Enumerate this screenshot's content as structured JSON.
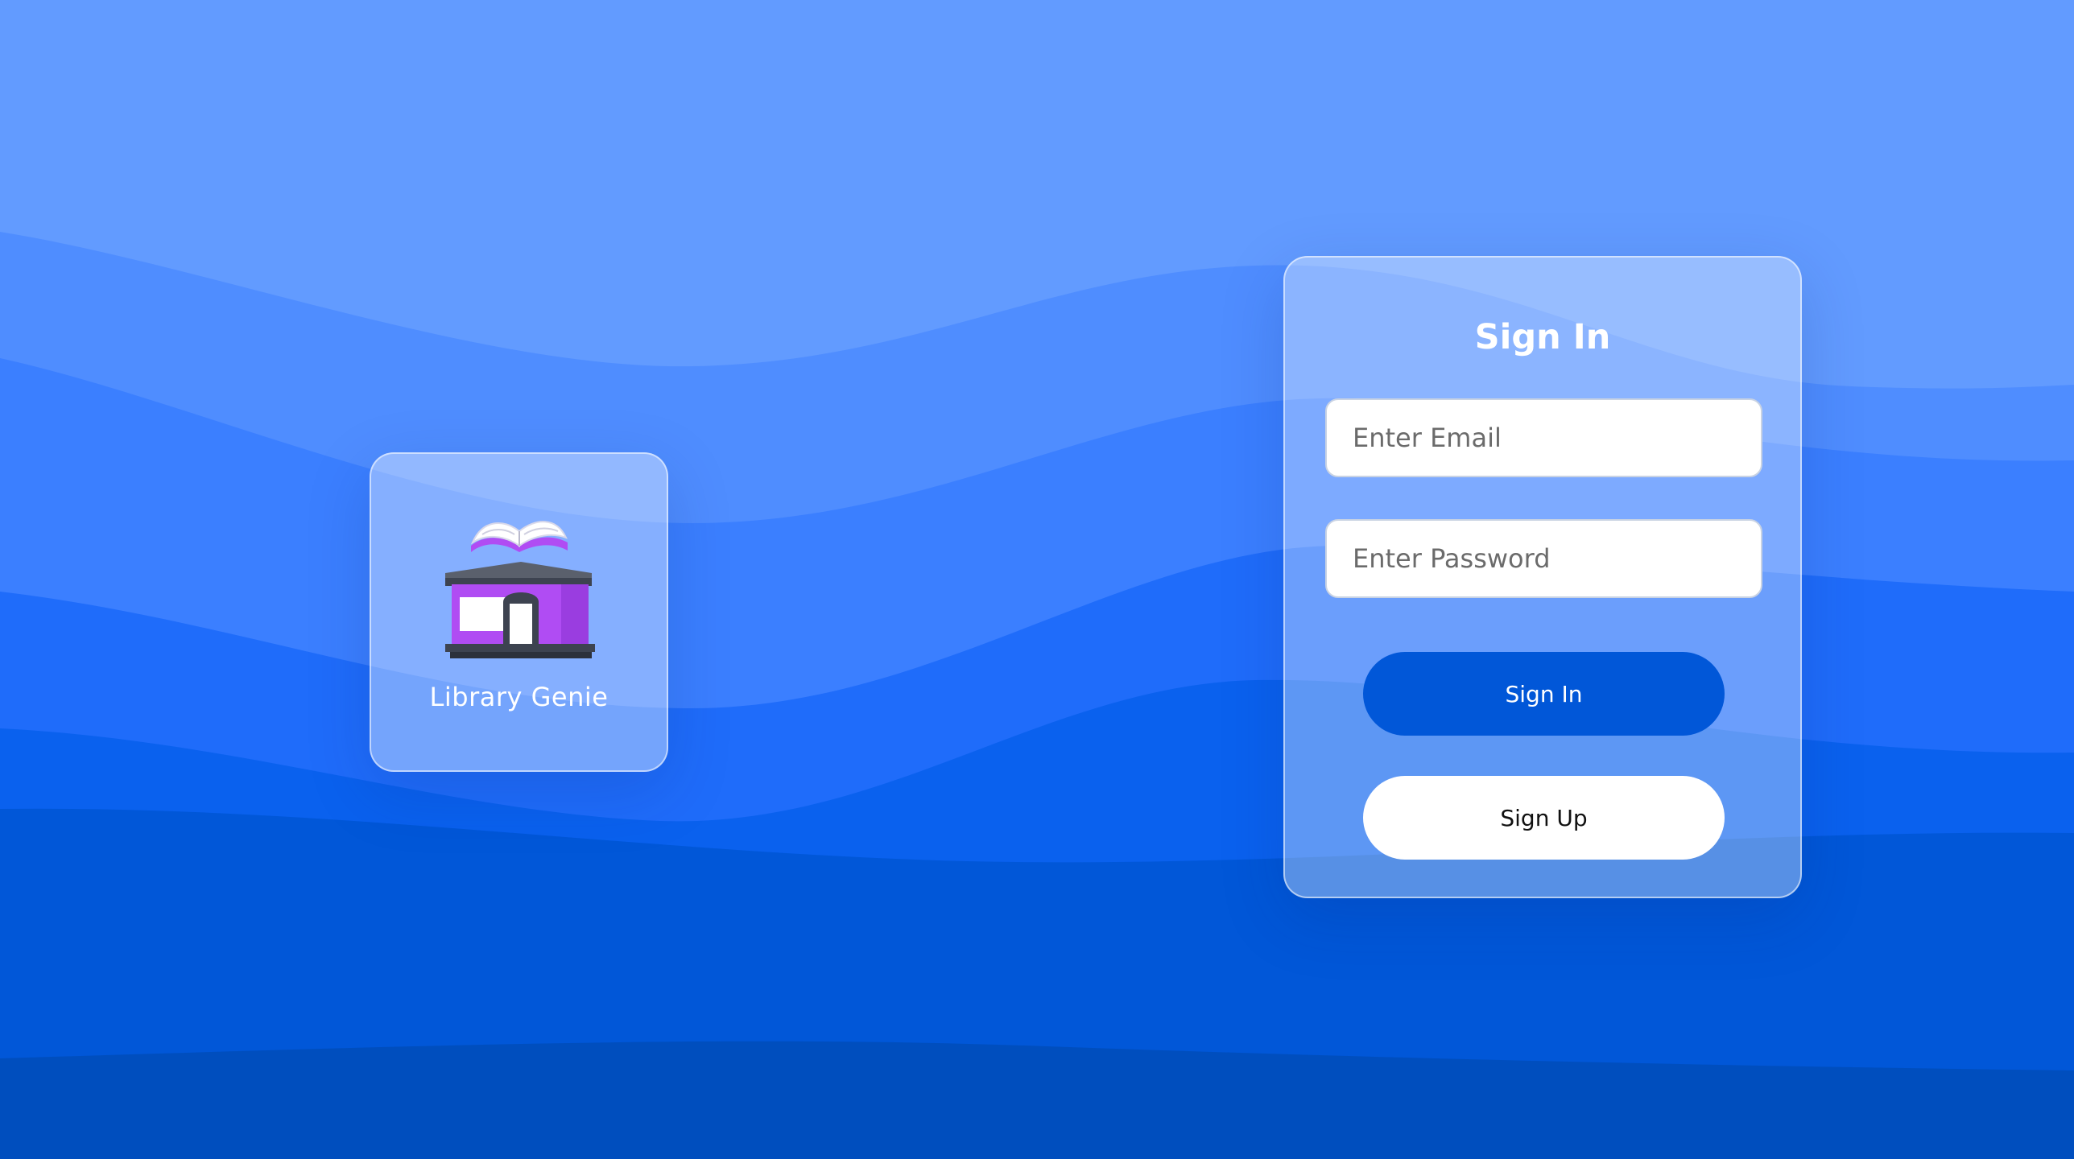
{
  "colors": {
    "background_top": "#629bff",
    "wave_1": "#4f8dff",
    "wave_2": "#3b7fff",
    "wave_3": "#1f6cfa",
    "wave_4": "#0a61ee",
    "wave_5": "#0157d8",
    "wave_6": "#004ebe",
    "primary_button": "#0157d8",
    "logo_building": "#b04cf3",
    "logo_base": "#444a55"
  },
  "brand": {
    "name": "Library Genie",
    "logo_icon": "library-building-with-open-book-icon"
  },
  "signin_form": {
    "title": "Sign In",
    "email_placeholder": "Enter Email",
    "email_value": "",
    "password_placeholder": "Enter Password",
    "password_value": "",
    "signin_button_label": "Sign In",
    "signup_button_label": "Sign Up"
  }
}
